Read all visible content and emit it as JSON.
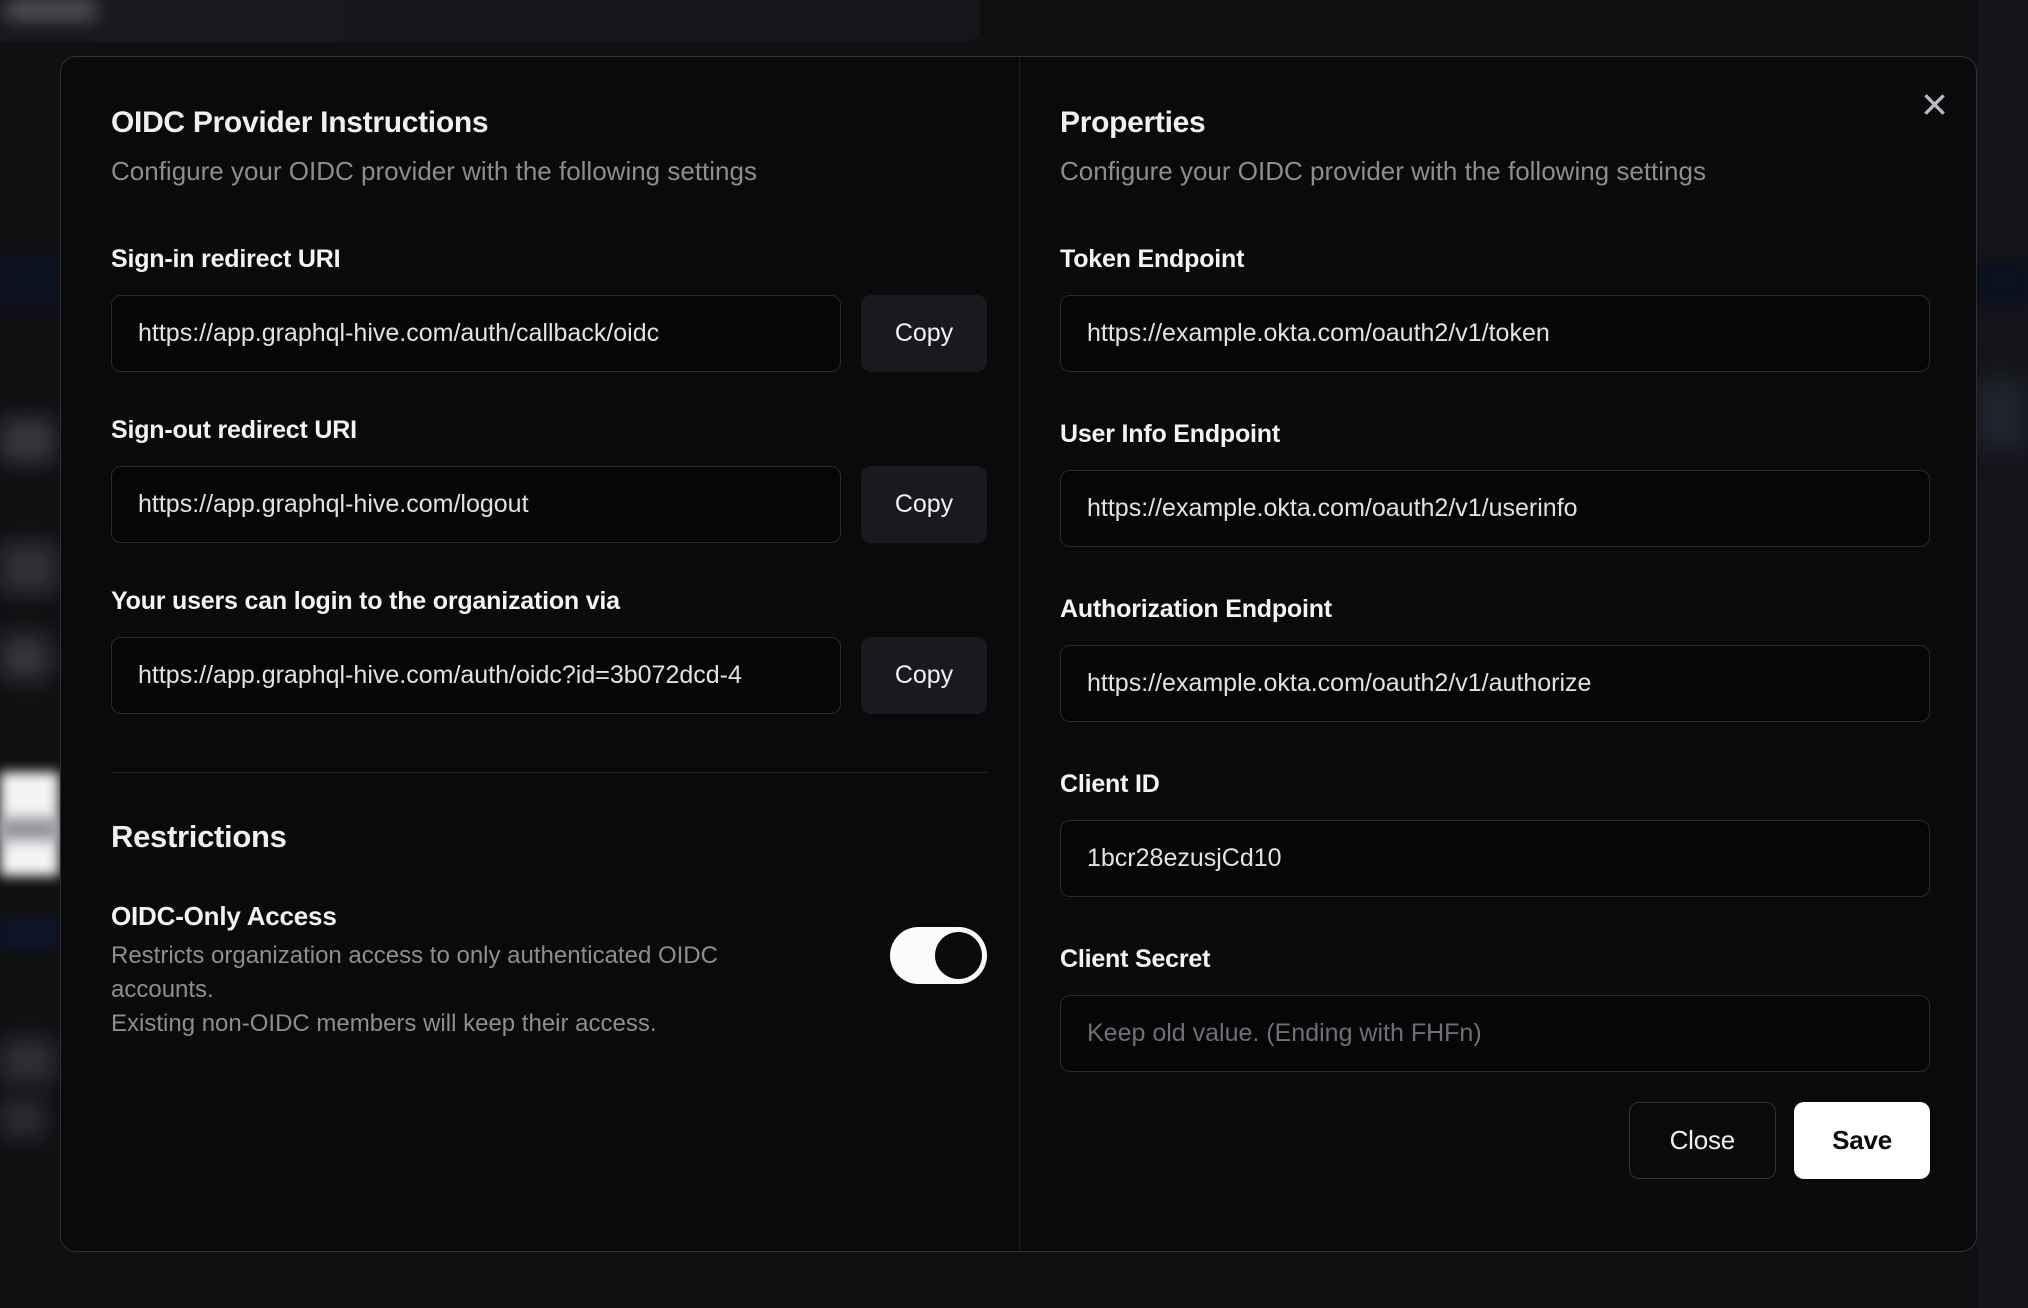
{
  "modal": {
    "close_icon_glyph": "×",
    "left": {
      "title": "OIDC Provider Instructions",
      "subtitle": "Configure your OIDC provider with the following settings",
      "fields": [
        {
          "label": "Sign-in redirect URI",
          "value": "https://app.graphql-hive.com/auth/callback/oidc",
          "copy_label": "Copy"
        },
        {
          "label": "Sign-out redirect URI",
          "value": "https://app.graphql-hive.com/logout",
          "copy_label": "Copy"
        },
        {
          "label": "Your users can login to the organization via",
          "value": "https://app.graphql-hive.com/auth/oidc?id=3b072dcd-4",
          "copy_label": "Copy"
        }
      ],
      "restrictions": {
        "heading": "Restrictions",
        "toggle_title": "OIDC-Only Access",
        "description_line1": "Restricts organization access to only authenticated OIDC accounts.",
        "description_line2": "Existing non-OIDC members will keep their access.",
        "toggle_state": "on"
      }
    },
    "right": {
      "title": "Properties",
      "subtitle": "Configure your OIDC provider with the following settings",
      "fields": [
        {
          "label": "Token Endpoint",
          "value": "https://example.okta.com/oauth2/v1/token",
          "placeholder": ""
        },
        {
          "label": "User Info Endpoint",
          "value": "https://example.okta.com/oauth2/v1/userinfo",
          "placeholder": ""
        },
        {
          "label": "Authorization Endpoint",
          "value": "https://example.okta.com/oauth2/v1/authorize",
          "placeholder": ""
        },
        {
          "label": "Client ID",
          "value": "1bcr28ezusjCd10",
          "placeholder": ""
        },
        {
          "label": "Client Secret",
          "value": "",
          "placeholder": "Keep old value. (Ending with FHFn)"
        }
      ],
      "buttons": {
        "close": "Close",
        "save": "Save"
      }
    },
    "colors": {
      "modal_background": "#0a0a0d",
      "input_background": "#060609",
      "accent_button": "#ffffff",
      "muted_text": "#8f8d89",
      "toggle_on_track": "#fbfbfd"
    }
  }
}
